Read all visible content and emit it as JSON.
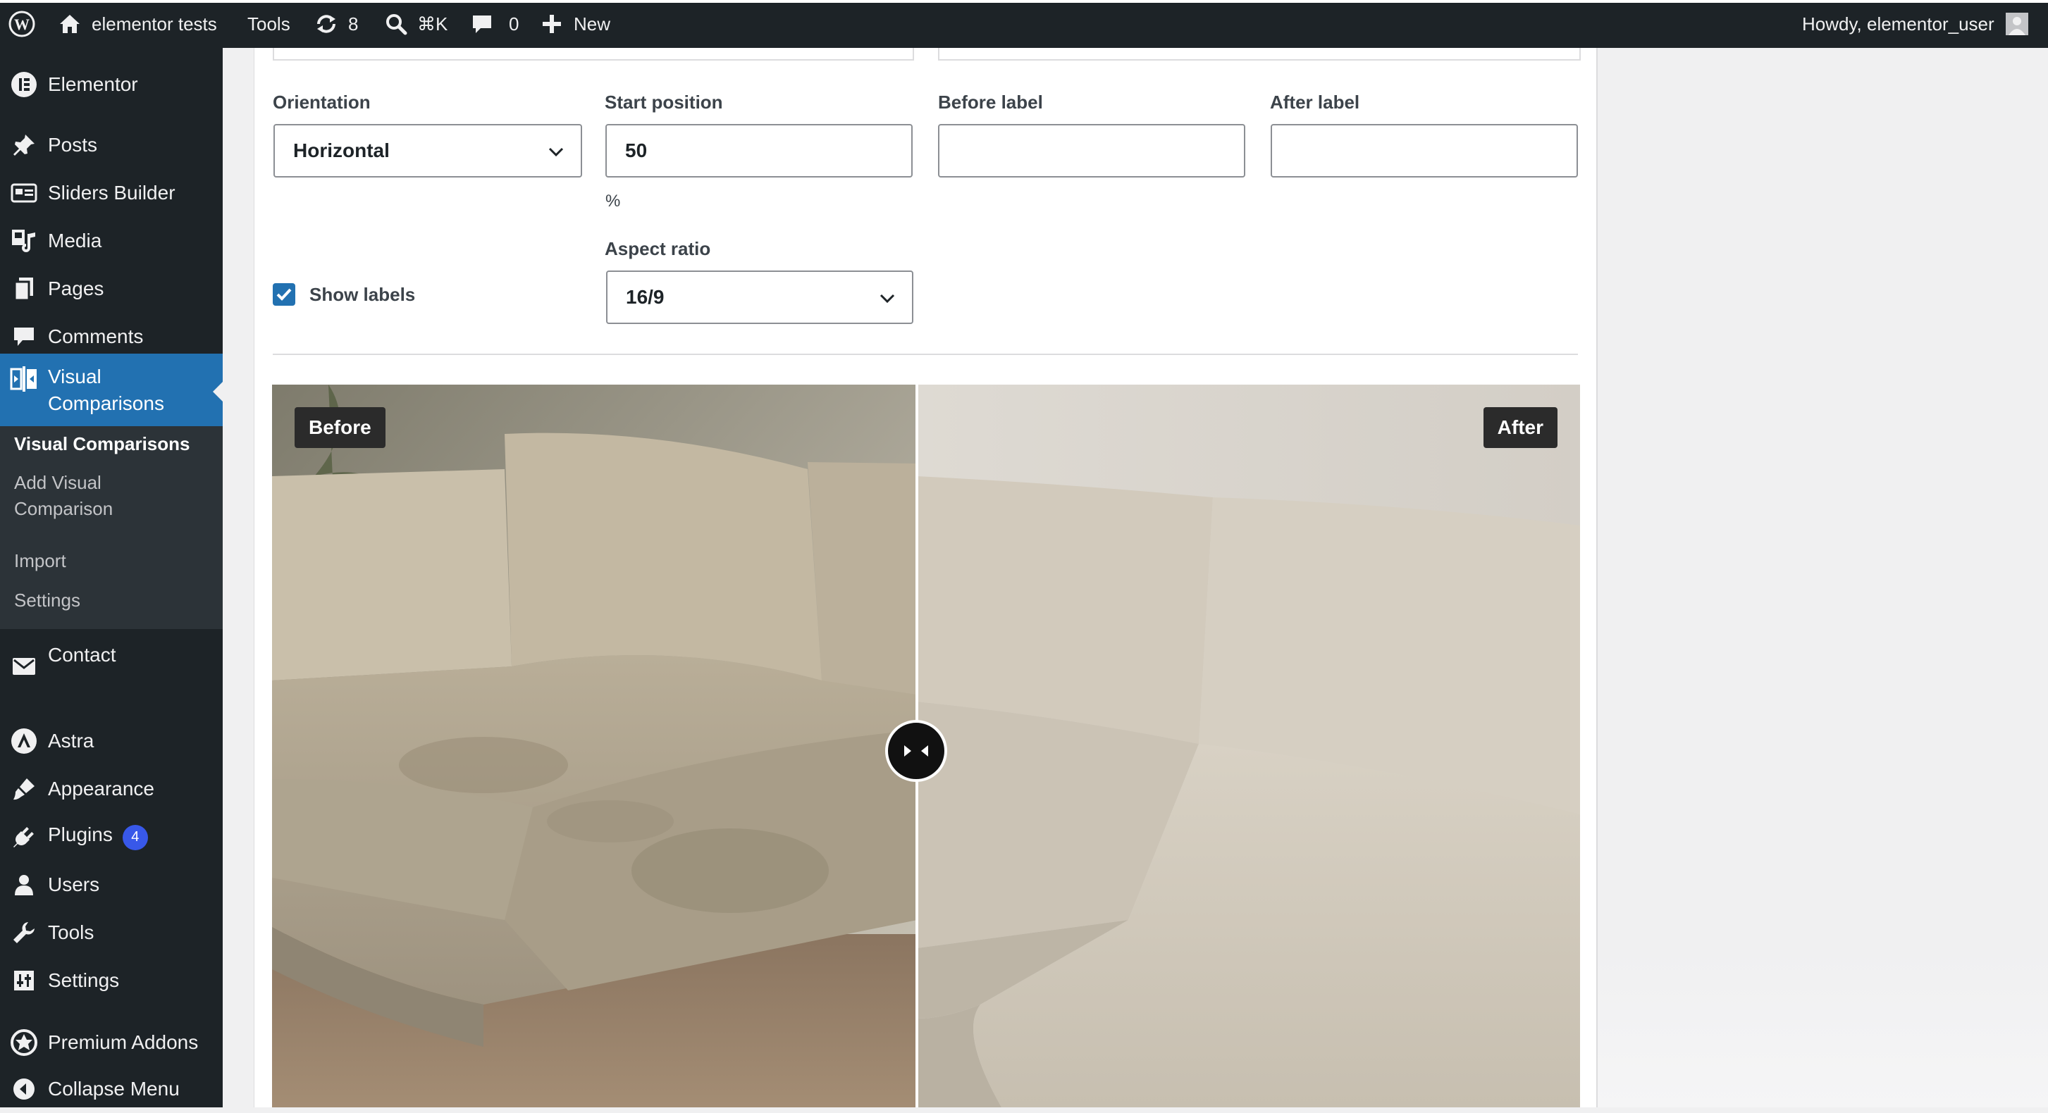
{
  "admin_bar": {
    "site_name": "elementor tests",
    "tools_label": "Tools",
    "updates_count": "8",
    "command_shortcut": "⌘K",
    "comments_count": "0",
    "new_label": "New",
    "greeting": "Howdy, elementor_user"
  },
  "sidebar": {
    "items": [
      {
        "label": "Elementor",
        "icon": "elementor-icon"
      },
      {
        "label": "Posts",
        "icon": "pin-icon"
      },
      {
        "label": "Sliders Builder",
        "icon": "slider-icon"
      },
      {
        "label": "Media",
        "icon": "media-icon"
      },
      {
        "label": "Pages",
        "icon": "pages-icon"
      },
      {
        "label": "Comments",
        "icon": "comment-icon"
      },
      {
        "label_line1": "Visual",
        "label_line2": "Comparisons",
        "icon": "compare-icon"
      },
      {
        "label": "Contact",
        "icon": "mail-icon"
      },
      {
        "label": "Astra",
        "icon": "astra-icon"
      },
      {
        "label": "Appearance",
        "icon": "brush-icon"
      },
      {
        "label": "Plugins",
        "icon": "plugin-icon",
        "badge": "4"
      },
      {
        "label": "Users",
        "icon": "user-icon"
      },
      {
        "label": "Tools",
        "icon": "wrench-icon"
      },
      {
        "label": "Settings",
        "icon": "settings-icon"
      },
      {
        "label": "Premium Addons",
        "icon": "premium-icon"
      },
      {
        "label": "Collapse Menu",
        "icon": "collapse-icon"
      }
    ],
    "submenu": {
      "current": "Visual Comparisons",
      "add_line1": "Add Visual",
      "add_line2": "Comparison",
      "import": "Import",
      "settings": "Settings"
    }
  },
  "form": {
    "orientation_label": "Orientation",
    "orientation_value": "Horizontal",
    "start_position_label": "Start position",
    "start_position_value": "50",
    "start_position_unit": "%",
    "before_label_label": "Before label",
    "before_label_value": "",
    "after_label_label": "After label",
    "after_label_value": "",
    "show_labels_text": "Show labels",
    "show_labels_checked": true,
    "aspect_ratio_label": "Aspect ratio",
    "aspect_ratio_value": "16/9"
  },
  "comparison": {
    "before_text": "Before",
    "after_text": "After",
    "position_percent": 50
  },
  "colors": {
    "admin_bar_bg": "#1d2327",
    "menu_current_bg": "#2271b1",
    "badge_bg": "#3858e9",
    "checkbox": "#2271b1"
  }
}
